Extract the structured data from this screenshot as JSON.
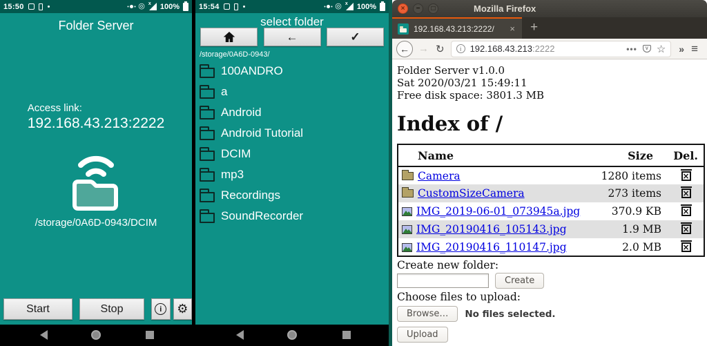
{
  "colors": {
    "teal": "#0e9187",
    "status_teal": "#02584e",
    "ubuntu_orange": "#e8590c",
    "link_blue": "#0000e0"
  },
  "left_app": {
    "status": {
      "time": "15:50",
      "battery": "100%"
    },
    "title": "Folder Server",
    "access_label": "Access link:",
    "access_link": "192.168.43.213:2222",
    "share_path": "/storage/0A6D-0943/DCIM",
    "start_label": "Start",
    "stop_label": "Stop",
    "info_glyph": "i"
  },
  "picker_app": {
    "status": {
      "time": "15:54",
      "battery": "100%"
    },
    "title": "select folder",
    "path": "/storage/0A6D-0943/",
    "folders": [
      "100ANDRO",
      "a",
      "Android",
      "Android Tutorial",
      "DCIM",
      "mp3",
      "Recordings",
      "SoundRecorder"
    ]
  },
  "browser": {
    "window_title": "Mozilla Firefox",
    "tab_title": "192.168.43.213:2222/",
    "url_host": "192.168.43.213",
    "url_port": ":2222",
    "page": {
      "info_lines": [
        "Folder Server v1.0.0",
        "Sat 2020/03/21 15:49:11",
        "Free disk space: 3801.3 MB"
      ],
      "heading": "Index of /",
      "table": {
        "headers": [
          "Name",
          "Size",
          "Del."
        ],
        "rows": [
          {
            "name": "Camera",
            "type": "folder",
            "size": "1280 items"
          },
          {
            "name": "CustomSizeCamera",
            "type": "folder",
            "size": "273 items"
          },
          {
            "name": "IMG_2019-06-01_073945a.jpg",
            "type": "image",
            "size": "370.9 KB"
          },
          {
            "name": "IMG_20190416_105143.jpg",
            "type": "image",
            "size": "1.9 MB"
          },
          {
            "name": "IMG_20190416_110147.jpg",
            "type": "image",
            "size": "2.0 MB"
          }
        ]
      },
      "create_folder_label": "Create new folder:",
      "create_button": "Create",
      "upload_label": "Choose files to upload:",
      "browse_button": "Browse…",
      "no_files_text": "No files selected.",
      "upload_button": "Upload"
    }
  }
}
